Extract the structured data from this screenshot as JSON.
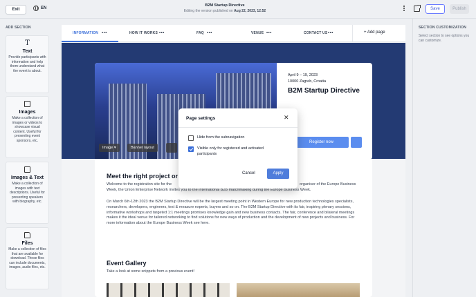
{
  "topbar": {
    "exit_label": "Exit",
    "language": "EN",
    "doc_title": "B2M Startup Directive",
    "editing_prefix": "Editing the version published on",
    "published_date": "Aug 22, 2023, 12:52",
    "save_label": "Save",
    "publish_label": "Publish"
  },
  "left_panel": {
    "heading": "ADD SECTION",
    "items": [
      {
        "icon": "text-icon",
        "title": "Text",
        "description": "Provide participants with information and help them understand what the event is about."
      },
      {
        "icon": "image-icon",
        "title": "Images",
        "description": "Make a collection of images or videos to showcase visual content. Useful for presenting event sponsors, etc."
      },
      {
        "icon": "image-text-icon",
        "title": "Images & Text",
        "description": "Make a collection of images with text descriptions. Useful for presenting speakers with biography, etc."
      },
      {
        "icon": "file-icon",
        "title": "Files",
        "description": "Make a collection of files that are available for download. These files can include documents, images, audio files, etc."
      }
    ]
  },
  "right_panel": {
    "heading": "SECTION CUSTOMIZATION",
    "hint": "Select section to see options you can customize."
  },
  "nav": {
    "tabs": [
      {
        "label": "INFORMATION",
        "active": true
      },
      {
        "label": "HOW IT WORKS",
        "active": false
      },
      {
        "label": "FAQ",
        "active": false
      },
      {
        "label": "VENUE",
        "active": false
      },
      {
        "label": "CONTACT US",
        "active": false
      }
    ],
    "more_glyph": "•••",
    "add_page": "+ Add page"
  },
  "hero": {
    "date": "April 9 – 19, 2023",
    "location": "10000 Zagreb, Croatia",
    "title": "B2M Startup Directive",
    "image_button": "Image",
    "banner_button": "Banner layout",
    "register_label": "Register now"
  },
  "content": {
    "heading": "Meet the right project or",
    "para1": "Welcome to the registration site for the ... organiser of the Europe Business Week, the Union Enterprise Network invites you to the international B2B matchmaking during the Europe Business Week.",
    "para1_visible_left": "Welcome to the registration site for the",
    "para1_visible_right": "organiser of the Europe Business",
    "para1_line2": "Week, the Union Enterprise Network invites you to the international B2B matchmaking during the Europe Business Week.",
    "para2": "On March 6th-12th 2023 the B2M Startup Directive will be the largest meeting point in Western Europe for new production technologies specialists, researchers, developers, engineers, test & measure experts, buyers and so on. The B2M Startup Directive with its fair, inspiring plenary sessions, informative workshops and targeted 1:1 meetings promises knowledge gain and new business contacts. The fair, conference and bilateral meetings makes it the ideal venue for tailored networking to find solutions for new ways of production and the development of new projects and business. For more information about the Europe Business Week see here.",
    "gallery_heading": "Event Gallery",
    "gallery_sub": "Take a look at some snippets from a previous event!"
  },
  "modal": {
    "title": "Page settings",
    "options": [
      {
        "label": "Hide from the subnavigation",
        "checked": false
      },
      {
        "label": "Visible only for registered and activated participants",
        "checked": true
      }
    ],
    "cancel_label": "Cancel",
    "apply_label": "Apply"
  },
  "colors": {
    "accent": "#3b6fd9",
    "hero_bg": "#233a73",
    "button": "#5b8def"
  }
}
